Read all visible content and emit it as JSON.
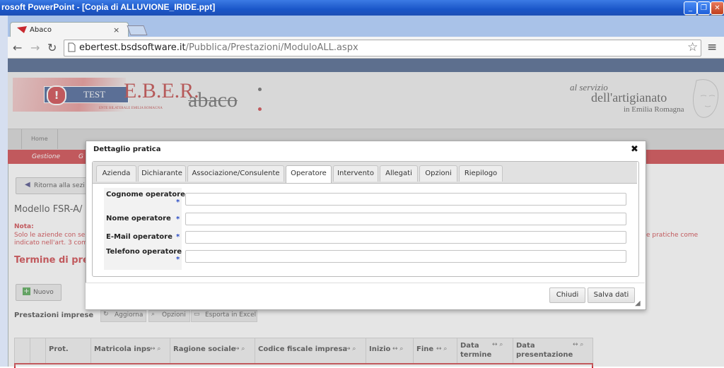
{
  "window": {
    "title": "rosoft PowerPoint - [Copia di ALLUVIONE_IRIDE.ppt]",
    "min": "_",
    "max": "❐",
    "close": "✕"
  },
  "browser": {
    "tab_title": "Abaco",
    "tab_close": "×",
    "url_host": "ebertest.bsdsoftware.it",
    "url_path": "/Pubblica/Prestazioni/ModuloALL.aspx"
  },
  "header": {
    "logo_test": "TEST",
    "logo_eber": "E.B.E.R.",
    "logo_eber_sub": "ENTE BILATERALE EMILIA ROMAGNA",
    "abaco": "abaco",
    "slogan1": "al servizio",
    "slogan2": "dell'artigianato",
    "slogan3": "in Emilia Romagna"
  },
  "nav": {
    "home": "Home",
    "gestione": "Gestione",
    "g2": "G"
  },
  "page": {
    "back_button": "Ritorna alla sezi",
    "title": "Modello FSR-A/",
    "note_label": "Nota:",
    "note_line1": "Solo le aziende con se",
    "note_line2": "indicato nell'art. 3 com",
    "note_right": "e pratiche come",
    "termine": "Termine di pres",
    "nuovo": "Nuovo",
    "prestazioni": "Prestazioni imprese",
    "aggiorna": "Aggiorna",
    "opzioni": "Opzioni",
    "esporta": "Esporta in Excel",
    "grid_cols": [
      "Prot.",
      "Matricola inps",
      "Ragione sociale",
      "Codice fiscale impresa",
      "Inizio",
      "Fine",
      "Data termine",
      "Data presentazione"
    ]
  },
  "modal": {
    "title": "Dettaglio pratica",
    "close": "✖",
    "tabs": [
      "Azienda",
      "Dichiarante",
      "Associazione/Consulente",
      "Operatore",
      "Intervento",
      "Allegati",
      "Opzioni",
      "Riepilogo"
    ],
    "active_tab": "Operatore",
    "fields": [
      {
        "label": "Cognome operatore",
        "value": ""
      },
      {
        "label": "Nome operatore",
        "value": ""
      },
      {
        "label": "E-Mail operatore",
        "value": ""
      },
      {
        "label": "Telefono operatore",
        "value": ""
      }
    ],
    "required_mark": "*",
    "chiudi": "Chiudi",
    "salva": "Salva dati"
  }
}
